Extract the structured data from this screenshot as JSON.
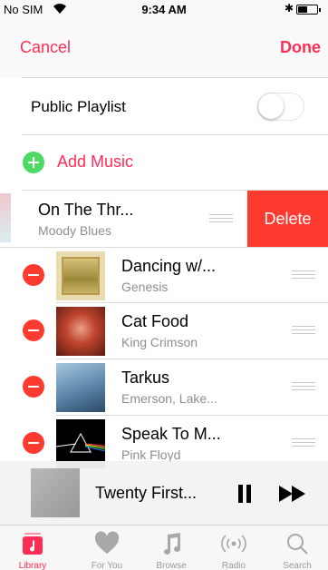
{
  "status_bar": {
    "carrier": "No SIM",
    "time": "9:34 AM"
  },
  "nav": {
    "cancel": "Cancel",
    "done": "Done"
  },
  "settings": {
    "public_playlist_label": "Public Playlist",
    "public_playlist_on": false
  },
  "add_music": {
    "label": "Add Music"
  },
  "swiped_track": {
    "title": "On The Thr...",
    "artist": "Moody Blues",
    "delete_label": "Delete"
  },
  "tracks": [
    {
      "title": "Dancing w/...",
      "artist": "Genesis"
    },
    {
      "title": "Cat Food",
      "artist": "King Crimson"
    },
    {
      "title": "Tarkus",
      "artist": "Emerson, Lake..."
    },
    {
      "title": "Speak To M...",
      "artist": "Pink Floyd"
    }
  ],
  "mini_player": {
    "title": "Twenty First..."
  },
  "tabs": [
    {
      "label": "Library",
      "icon": "library-icon",
      "active": true
    },
    {
      "label": "For You",
      "icon": "heart-icon",
      "active": false
    },
    {
      "label": "Browse",
      "icon": "music-note-icon",
      "active": false
    },
    {
      "label": "Radio",
      "icon": "radio-icon",
      "active": false
    },
    {
      "label": "Search",
      "icon": "search-icon",
      "active": false
    }
  ],
  "colors": {
    "accent": "#ff2d55",
    "delete": "#ff3b30",
    "add": "#4cd964"
  }
}
